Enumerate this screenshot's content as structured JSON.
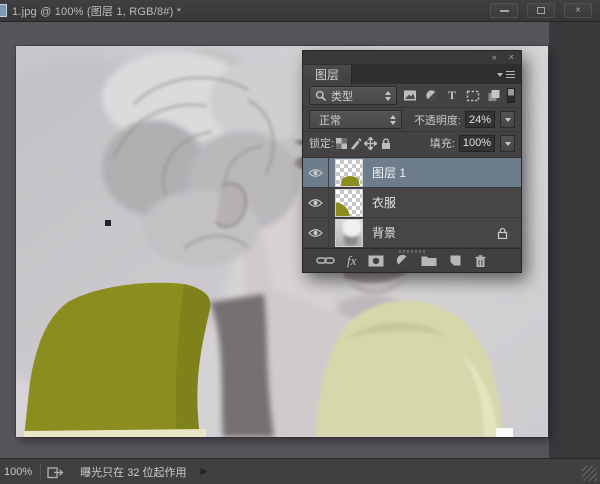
{
  "titlebar": {
    "title": "1.jpg @ 100% (图层 1, RGB/8#) *",
    "controls": {
      "close": "×"
    }
  },
  "panel": {
    "collapse_glyph": "»",
    "close_glyph": "×",
    "tab_label": "图层",
    "filter": {
      "type_label": "类型",
      "type_tool_glyph": "T"
    },
    "blend": {
      "mode": "正常",
      "opacity_label": "不透明度:",
      "opacity_value": "24%"
    },
    "lock": {
      "label": "锁定:",
      "fill_label": "填充:",
      "fill_value": "100%"
    },
    "layers": [
      {
        "name": "图层 1",
        "selected": true,
        "thumb": "transparent-with-olive-shape"
      },
      {
        "name": "衣服",
        "selected": false,
        "thumb": "transparent-with-olive-shape"
      },
      {
        "name": "背景",
        "selected": false,
        "locked": true,
        "thumb": "grayscale-portrait"
      }
    ],
    "footer": {
      "fx_label": "fx"
    },
    "footer_icons": [
      "link-icon",
      "fx-icon",
      "add-mask-icon",
      "adjustment-icon",
      "new-group-icon",
      "new-layer-icon",
      "delete-icon"
    ]
  },
  "statusbar": {
    "zoom_value": "100%",
    "message": "曝光只在 32 位起作用",
    "menu_arrow": "▶"
  },
  "colors": {
    "olive_shirt": "#8b8e1f",
    "pale_shirt": "#d5d8ab",
    "selected_layer_row": "#6d7d8c",
    "panel_bg": "#444243",
    "canvas_bg": "#d3d1d4"
  },
  "icons": {
    "search": "magnifier",
    "eye": "layer-visibility",
    "lock": "padlock",
    "move": "cross-arrows",
    "brush": "paintbrush",
    "checker": "transparency-grid"
  }
}
